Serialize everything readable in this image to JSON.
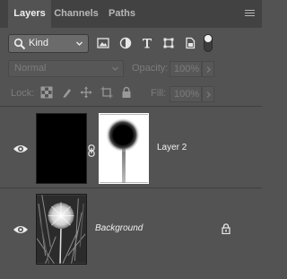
{
  "tabs": [
    {
      "label": "Layers",
      "active": true
    },
    {
      "label": "Channels",
      "active": false
    },
    {
      "label": "Paths",
      "active": false
    }
  ],
  "filter": {
    "kind_label": "Kind",
    "icons": [
      "image-filter-icon",
      "adjustment-filter-icon",
      "type-filter-icon",
      "shape-filter-icon",
      "smart-object-filter-icon",
      "filter-toggle-icon"
    ]
  },
  "blend": {
    "mode": "Normal",
    "opacity_label": "Opacity:",
    "opacity_value": "100%",
    "fill_label": "Fill:",
    "fill_value": "100%"
  },
  "lock": {
    "label": "Lock:",
    "icons": [
      "lock-transparent-pixels-icon",
      "lock-image-pixels-icon",
      "lock-position-icon",
      "lock-artboard-icon",
      "lock-all-icon"
    ]
  },
  "layers": [
    {
      "name": "Layer 2",
      "visible": true,
      "has_mask": true,
      "italic": false,
      "locked": false
    },
    {
      "name": "Background",
      "visible": true,
      "has_mask": false,
      "italic": true,
      "locked": true
    }
  ],
  "colors": {
    "panel_bg": "#535353",
    "tab_bar_bg": "#424242",
    "text": "#f0f0f0",
    "disabled_text": "#7c7c7c"
  }
}
